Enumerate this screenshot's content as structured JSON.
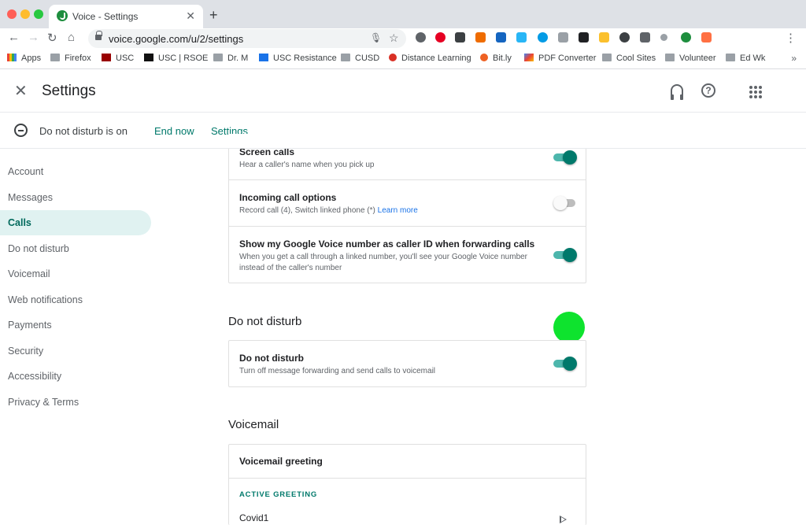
{
  "browser": {
    "tab_title": "Voice - Settings",
    "tab_close": "✕",
    "new_tab": "+",
    "url": "voice.google.com/u/2/settings",
    "bookmarks": [
      "Apps",
      "Firefox",
      "USC",
      "USC | RSOE",
      "Dr. M",
      "USC Resistance",
      "CUSD",
      "Distance Learning",
      "Bit.ly",
      "PDF Converter",
      "Cool Sites",
      "Volunteer",
      "Ed Wk"
    ],
    "bookmarks_more": "»"
  },
  "header": {
    "title": "Settings",
    "help_glyph": "?"
  },
  "dnd_banner": {
    "message": "Do not disturb is on",
    "end_now": "End now",
    "settings": "Settings"
  },
  "sidebar": {
    "items": [
      "Account",
      "Messages",
      "Calls",
      "Do not disturb",
      "Voicemail",
      "Web notifications",
      "Payments",
      "Security",
      "Accessibility",
      "Privacy & Terms"
    ],
    "active": "Calls"
  },
  "calls": {
    "screen_calls": {
      "title": "Screen calls",
      "desc": "Hear a caller's name when you pick up",
      "on": true
    },
    "incoming": {
      "title": "Incoming call options",
      "desc": "Record call (4), Switch linked phone (*)",
      "link": "Learn more",
      "on": false
    },
    "caller_id": {
      "title": "Show my Google Voice number as caller ID when forwarding calls",
      "desc": "When you get a call through a linked number, you'll see your Google Voice number instead of the caller's number",
      "on": true
    }
  },
  "dnd_section": {
    "heading": "Do not disturb",
    "title": "Do not disturb",
    "desc": "Turn off message forwarding and send calls to voicemail",
    "on": true
  },
  "voicemail": {
    "heading": "Voicemail",
    "greeting_title": "Voicemail greeting",
    "active_label": "ACTIVE GREETING",
    "greeting_name": "Covid1"
  },
  "colors": {
    "accent": "#00796b",
    "cursor_highlight": "#0ee32e"
  }
}
